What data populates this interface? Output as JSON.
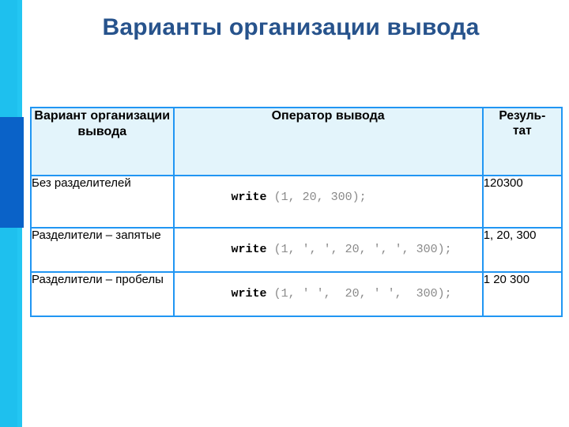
{
  "slide": {
    "title": "Варианты организации вывода",
    "decor": {
      "stripe_cyan": "#1EC0EE",
      "stripe_cyan_thin": "#23C6F2",
      "stripe_navy": "#0A62C8",
      "title_color": "#27538C",
      "table_border": "#2196F3",
      "header_fill": "#E3F4FB",
      "code_keyword_color": "#000000",
      "code_args_color": "#8A8A8A"
    }
  },
  "table": {
    "headers": {
      "variant": "Вариант организации вывода",
      "operator": "Оператор вывода",
      "result": "Резуль-\nтат"
    },
    "rows": [
      {
        "variant": "Без разделителей",
        "code_keyword": "write",
        "code_args": " (1, 20, 300);",
        "result": "120300"
      },
      {
        "variant": "Разделители – запятые",
        "code_keyword": "write",
        "code_args": " (1, ', ', 20, ', ', 300);",
        "result": "1, 20, 300"
      },
      {
        "variant": "Разделители – пробелы",
        "code_keyword": "write",
        "code_args": " (1, ' ',  20, ' ',  300);",
        "result": "1 20 300"
      }
    ]
  }
}
